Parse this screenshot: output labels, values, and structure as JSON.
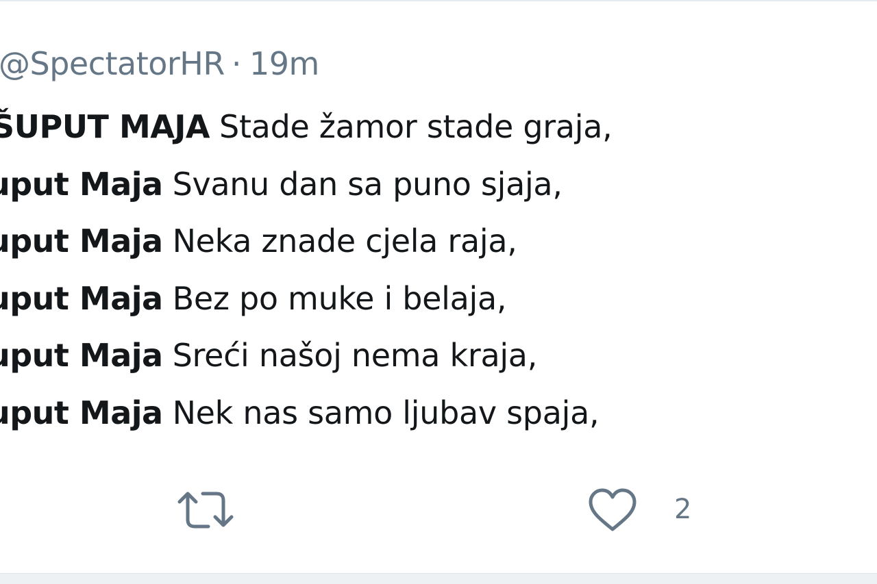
{
  "tweet": {
    "handle": "@SpectatorHR",
    "separator": "·",
    "time": "19m",
    "lines": [
      {
        "bold": "ŠUPUT MAJA",
        "text": "Stade žamor stade graja,"
      },
      {
        "bold": "uput Maja",
        "text": "Svanu dan sa puno sjaja,"
      },
      {
        "bold": "uput Maja",
        "text": "Neka znade cjela raja,"
      },
      {
        "bold": "uput Maja",
        "text": "Bez po muke i belaja,"
      },
      {
        "bold": "uput Maja",
        "text": "Sreći našoj nema kraja,"
      },
      {
        "bold": "uput Maja",
        "text": "Nek nas samo ljubav spaja,"
      }
    ],
    "actions": {
      "retweet_icon": "retweet-icon",
      "like_icon": "heart-icon",
      "like_count": "2"
    }
  },
  "colors": {
    "text_primary": "#14171a",
    "text_secondary": "#657786",
    "border": "#e6ecf0"
  }
}
